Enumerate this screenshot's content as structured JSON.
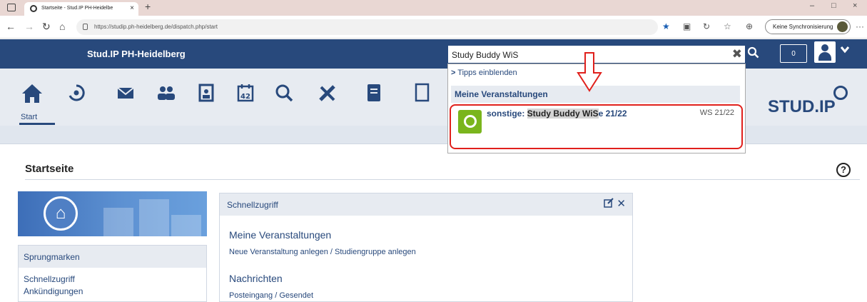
{
  "browser": {
    "tab_title": "Startseite - Stud.IP PH-Heidelbe",
    "tab_close": "×",
    "new_tab": "+",
    "url": "https://studip.ph-heidelberg.de/dispatch.php/start",
    "sync_label": "Keine Synchronisierung",
    "minimize": "–",
    "maximize": "□",
    "close": "×",
    "back": "←",
    "forward": "→",
    "reload": "↻",
    "home": "⌂",
    "more": "···"
  },
  "header": {
    "brand": "Stud.IP PH-Heidelberg",
    "counter": "0",
    "search_value": "Study Buddy WiS"
  },
  "search_dropdown": {
    "tips_label": "Tipps einblenden",
    "section": "Meine Veranstaltungen",
    "result_prefix": "sonstige: ",
    "result_match": "Study Buddy WiS",
    "result_suffix": "e 21/22",
    "result_semester": "WS 21/22"
  },
  "nav": {
    "home_label": "Start",
    "logo_text": "STUD.IP",
    "icons": [
      "home-icon",
      "studip-icon",
      "mail-icon",
      "community-icon",
      "profile-icon",
      "calendar-icon",
      "search-icon",
      "tools-icon",
      "files-icon",
      "documents-icon"
    ]
  },
  "main": {
    "title": "Startseite",
    "help": "?"
  },
  "sidebar": {
    "head": "Sprungmarken",
    "links": [
      "Schnellzugriff",
      "Ankündigungen"
    ]
  },
  "widget": {
    "title": "Schnellzugriff",
    "sections": [
      {
        "title": "Meine Veranstaltungen",
        "links": "Neue Veranstaltung anlegen / Studiengruppe anlegen"
      },
      {
        "title": "Nachrichten",
        "links": "Posteingang / Gesendet"
      }
    ]
  },
  "colors": {
    "brand_blue": "#28497c",
    "highlight_red": "#e0201c",
    "course_green": "#7ab51d"
  }
}
